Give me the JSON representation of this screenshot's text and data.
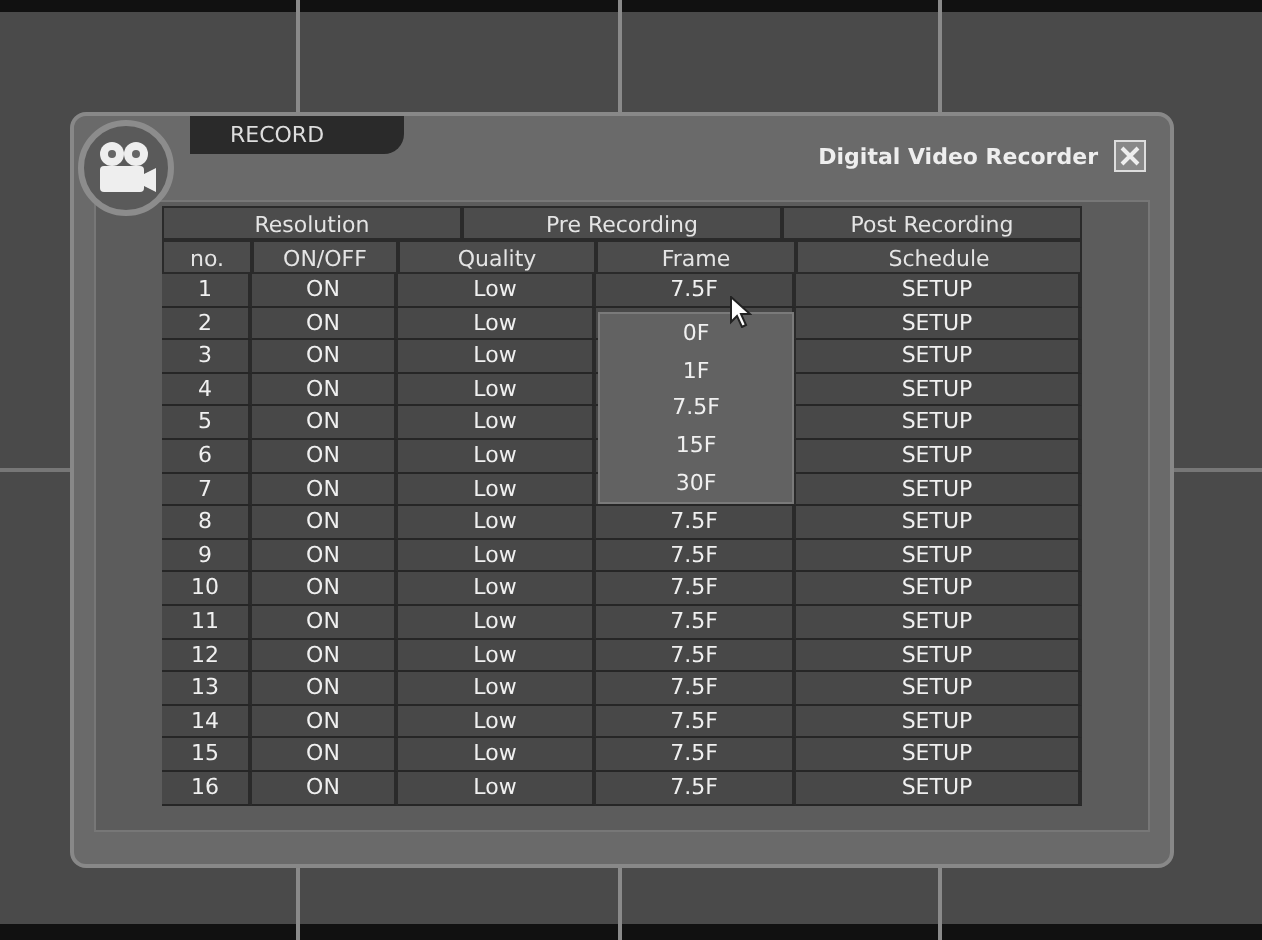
{
  "window": {
    "tab_label": "RECORD",
    "title": "Digital Video Recorder"
  },
  "header_groups": [
    "Resolution",
    "Pre Recording",
    "Post Recording"
  ],
  "columns": [
    "no.",
    "ON/OFF",
    "Quality",
    "Frame",
    "Schedule"
  ],
  "rows": [
    {
      "no": "1",
      "on_off": "ON",
      "quality": "Low",
      "frame": "7.5F",
      "schedule": "SETUP"
    },
    {
      "no": "2",
      "on_off": "ON",
      "quality": "Low",
      "schedule": "SETUP"
    },
    {
      "no": "3",
      "on_off": "ON",
      "quality": "Low",
      "schedule": "SETUP"
    },
    {
      "no": "4",
      "on_off": "ON",
      "quality": "Low",
      "schedule": "SETUP"
    },
    {
      "no": "5",
      "on_off": "ON",
      "quality": "Low",
      "schedule": "SETUP"
    },
    {
      "no": "6",
      "on_off": "ON",
      "quality": "Low",
      "schedule": "SETUP"
    },
    {
      "no": "7",
      "on_off": "ON",
      "quality": "Low",
      "schedule": "SETUP"
    },
    {
      "no": "8",
      "on_off": "ON",
      "quality": "Low",
      "frame": "7.5F",
      "schedule": "SETUP"
    },
    {
      "no": "9",
      "on_off": "ON",
      "quality": "Low",
      "frame": "7.5F",
      "schedule": "SETUP"
    },
    {
      "no": "10",
      "on_off": "ON",
      "quality": "Low",
      "frame": "7.5F",
      "schedule": "SETUP"
    },
    {
      "no": "11",
      "on_off": "ON",
      "quality": "Low",
      "frame": "7.5F",
      "schedule": "SETUP"
    },
    {
      "no": "12",
      "on_off": "ON",
      "quality": "Low",
      "frame": "7.5F",
      "schedule": "SETUP"
    },
    {
      "no": "13",
      "on_off": "ON",
      "quality": "Low",
      "frame": "7.5F",
      "schedule": "SETUP"
    },
    {
      "no": "14",
      "on_off": "ON",
      "quality": "Low",
      "frame": "7.5F",
      "schedule": "SETUP"
    },
    {
      "no": "15",
      "on_off": "ON",
      "quality": "Low",
      "frame": "7.5F",
      "schedule": "SETUP"
    },
    {
      "no": "16",
      "on_off": "ON",
      "quality": "Low",
      "frame": "7.5F",
      "schedule": "SETUP"
    }
  ],
  "frame_dropdown": {
    "expanded": true,
    "options": [
      "0F",
      "1F",
      "7.5F",
      "15F",
      "30F"
    ]
  }
}
